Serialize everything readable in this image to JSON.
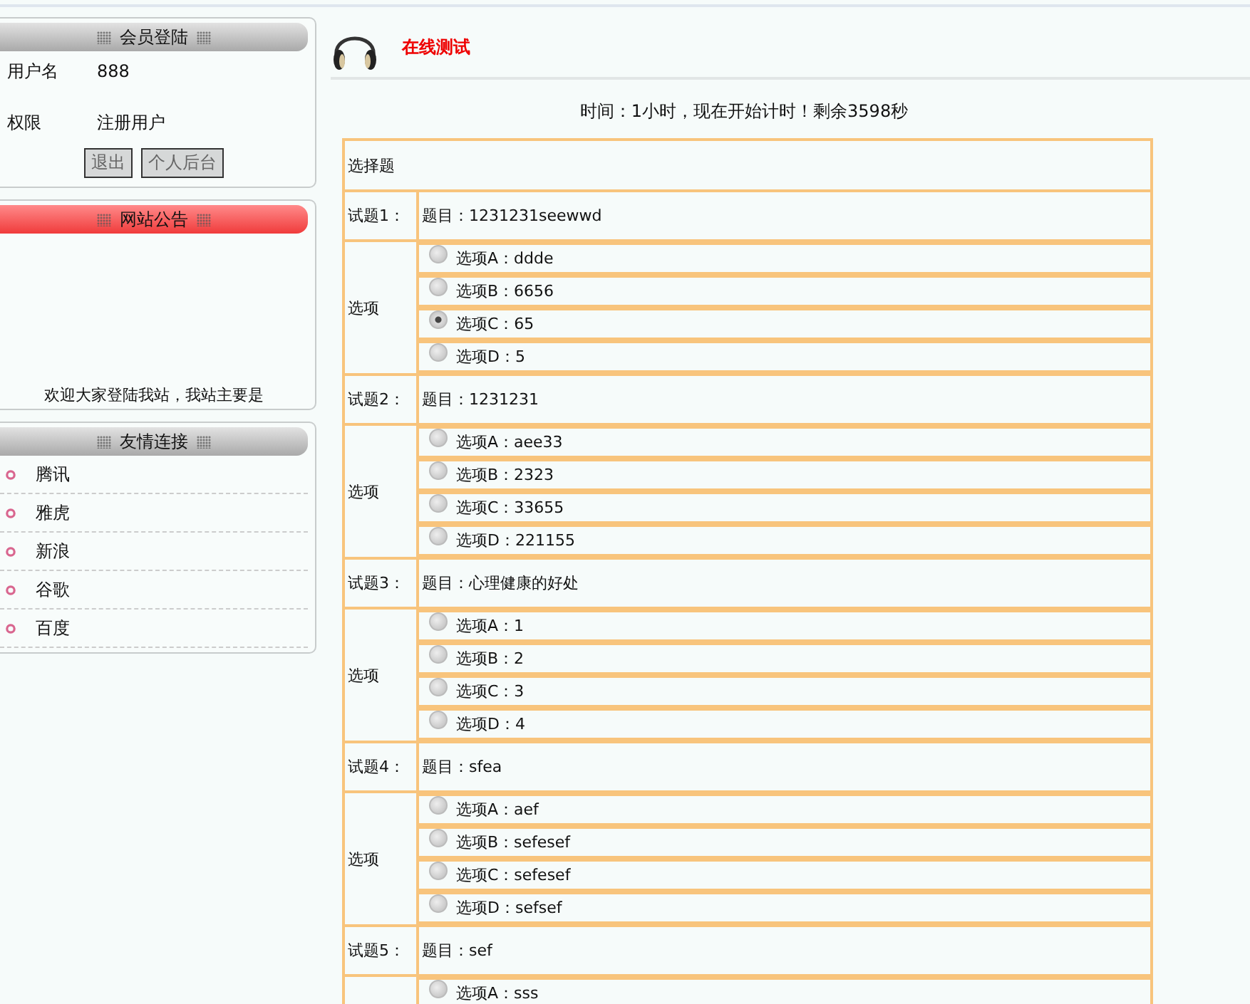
{
  "sidebar": [
    {
      "kind": "login",
      "title": "会员登陆",
      "fields": [
        {
          "label": "用户名",
          "value": "888"
        },
        {
          "label": "权限",
          "value": "注册用户"
        }
      ],
      "buttons": [
        "退出",
        "个人后台"
      ]
    },
    {
      "kind": "notice",
      "title": "网站公告",
      "text": "欢迎大家登陆我站，我站主要是"
    },
    {
      "kind": "links",
      "title": "友情连接",
      "items": [
        "腾讯",
        "雅虎",
        "新浪",
        "谷歌",
        "百度"
      ]
    }
  ],
  "main": {
    "title": "在线测试",
    "timer": "时间：1小时，现在开始计时！剩余3598秒",
    "section": "选择题",
    "questions": [
      {
        "label": "试题1：",
        "text": "题目：1231231seewwd",
        "options_label": "选项",
        "options": [
          {
            "text": "选项A：ddde",
            "selected": false
          },
          {
            "text": "选项B：6656",
            "selected": false
          },
          {
            "text": "选项C：65",
            "selected": true
          },
          {
            "text": "选项D：5",
            "selected": false
          }
        ]
      },
      {
        "label": "试题2：",
        "text": "题目：1231231",
        "options_label": "选项",
        "options": [
          {
            "text": "选项A：aee33",
            "selected": false
          },
          {
            "text": "选项B：2323",
            "selected": false
          },
          {
            "text": "选项C：33655",
            "selected": false
          },
          {
            "text": "选项D：221155",
            "selected": false
          }
        ]
      },
      {
        "label": "试题3：",
        "text": "题目：心理健康的好处",
        "options_label": "选项",
        "options": [
          {
            "text": "选项A：1",
            "selected": false
          },
          {
            "text": "选项B：2",
            "selected": false
          },
          {
            "text": "选项C：3",
            "selected": false
          },
          {
            "text": "选项D：4",
            "selected": false
          }
        ]
      },
      {
        "label": "试题4：",
        "text": "题目：sfea",
        "options_label": "选项",
        "options": [
          {
            "text": "选项A：aef",
            "selected": false
          },
          {
            "text": "选项B：sefesef",
            "selected": false
          },
          {
            "text": "选项C：sefesef",
            "selected": false
          },
          {
            "text": "选项D：sefsef",
            "selected": false
          }
        ]
      },
      {
        "label": "试题5：",
        "text": "题目：sef",
        "options": [
          {
            "text": "选项A：sss",
            "selected": false
          }
        ]
      }
    ]
  }
}
